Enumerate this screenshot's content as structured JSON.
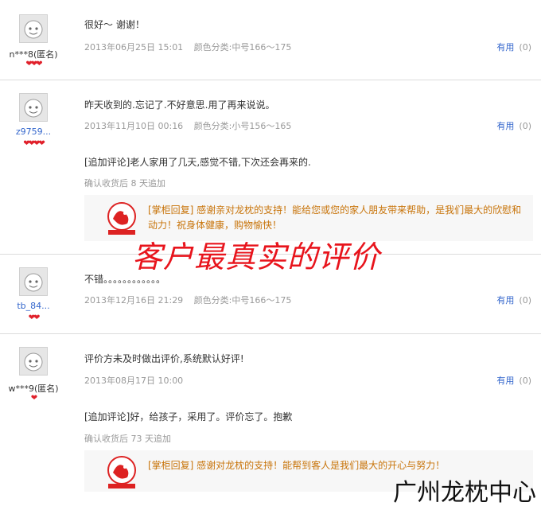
{
  "reviews": [
    {
      "user": {
        "name": "n***8(匿名)",
        "rank": "❤❤❤",
        "avatar_icon": "smiley-face-icon"
      },
      "text": "很好～   谢谢！",
      "date": "2013年06月25日 15:01",
      "sku": "颜色分类:中号166～175",
      "useful_label": "有用",
      "useful_count": "(0)"
    },
    {
      "user": {
        "name": "z9759...",
        "rank": "❤❤❤❤",
        "avatar_icon": "smiley-face-icon"
      },
      "text": "昨天收到的.忘记了.不好意思.用了再来说说。",
      "date": "2013年11月10日 00:16",
      "sku": "颜色分类:小号156～165",
      "useful_label": "有用",
      "useful_count": "(0)",
      "append_text": "[追加评论]老人家用了几天,感觉不错,下次还会再来的.",
      "append_meta": "确认收货后 8 天追加",
      "reply": "[掌柜回复] 感谢亲对龙枕的支持！能给您或您的家人朋友带来帮助，是我们最大的欣慰和动力！祝身体健康，购物愉快！"
    },
    {
      "user": {
        "name": "tb_84...",
        "rank": "❤❤",
        "avatar_icon": "smiley-face-icon"
      },
      "text": "不错。。。。。。。。。。。。",
      "date": "2013年12月16日 21:29",
      "sku": "颜色分类:中号166～175",
      "useful_label": "有用",
      "useful_count": "(0)"
    },
    {
      "user": {
        "name": "w***9(匿名)",
        "rank": "❤",
        "avatar_icon": "smiley-face-icon"
      },
      "text": "评价方未及时做出评价,系统默认好评!",
      "date": "2013年08月17日 10:00",
      "sku": "",
      "useful_label": "有用",
      "useful_count": "(0)",
      "append_text": "[追加评论]好，给孩子，采用了。评价忘了。抱歉",
      "append_meta": "确认收货后 73 天追加",
      "reply": "[掌柜回复] 感谢对龙枕的支持！能帮到客人是我们最大的开心与努力！"
    }
  ],
  "overlay": {
    "watermark": "客户最真实的评价",
    "brand": "广州龙枕中心"
  },
  "colors": {
    "link": "#3366cc",
    "reply_text": "#c8740a",
    "watermark": "#e8141c",
    "rank": "#e0202a"
  }
}
